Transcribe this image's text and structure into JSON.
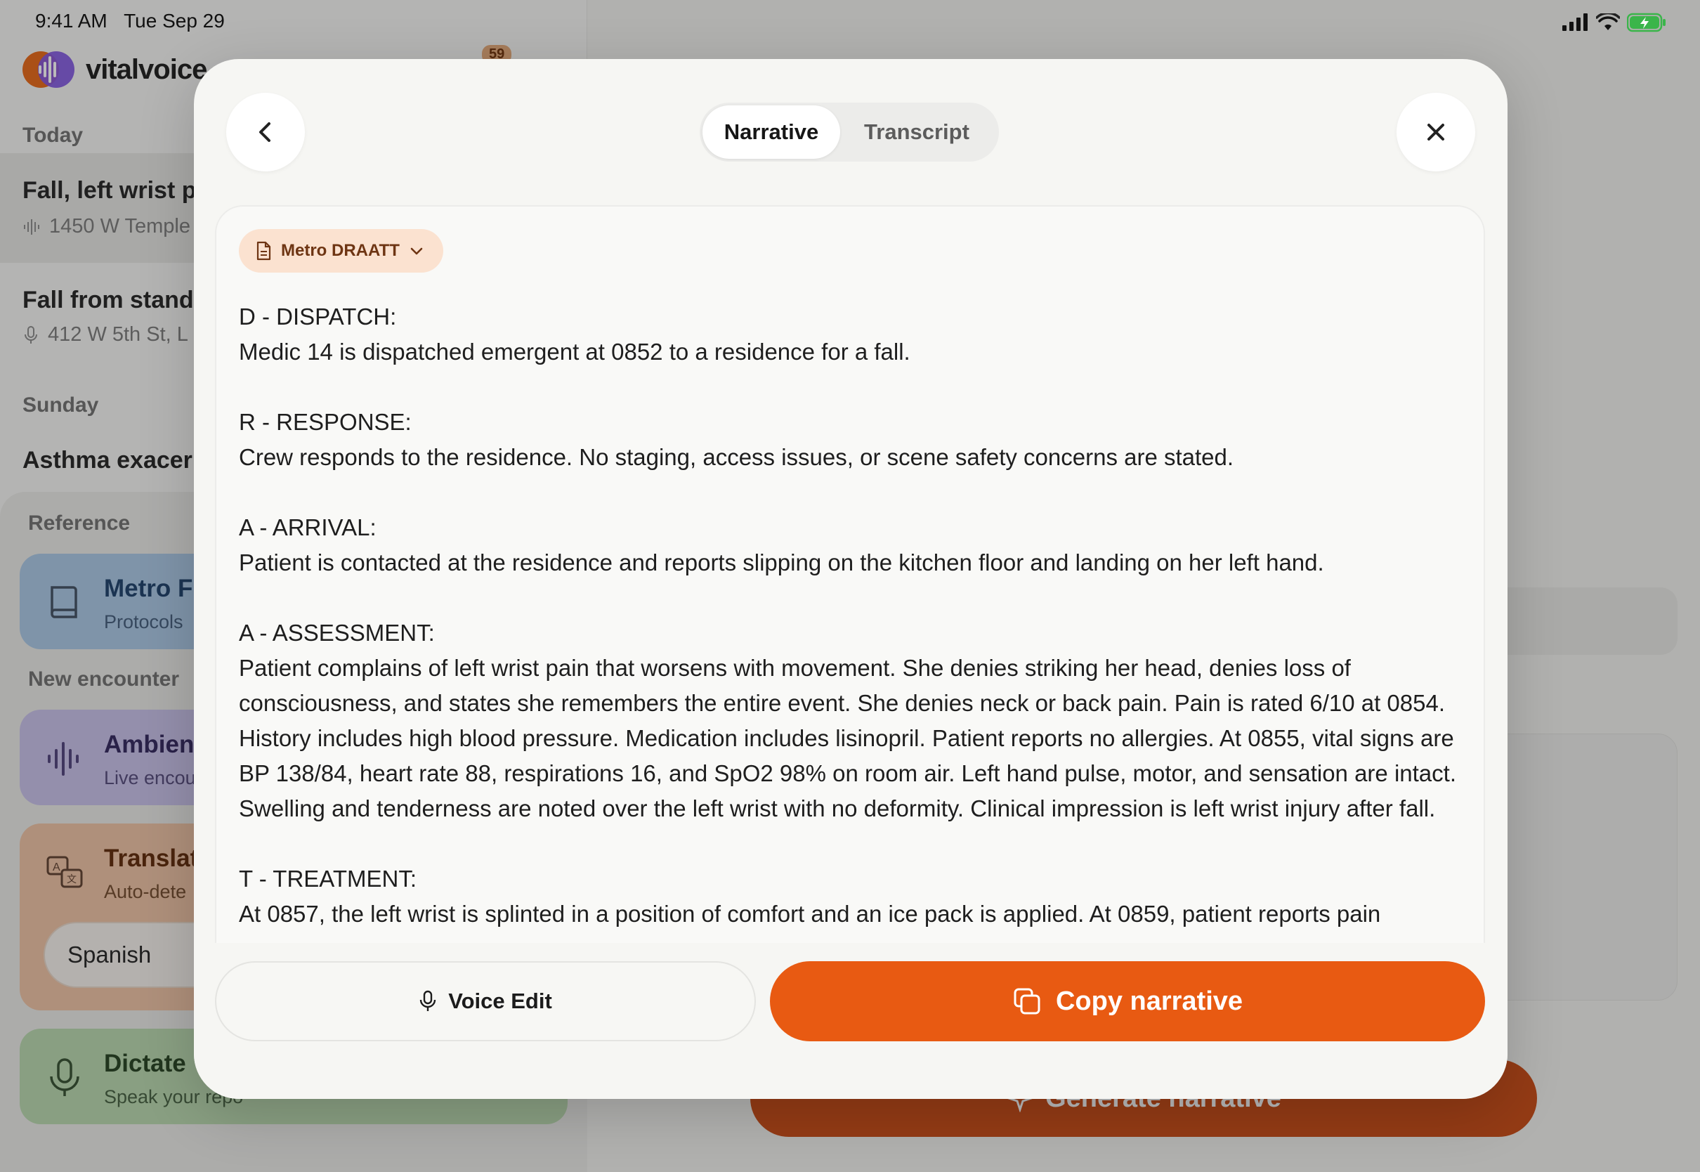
{
  "status": {
    "time": "9:41 AM",
    "date": "Tue Sep 29"
  },
  "brand": {
    "name": "vitalvoice",
    "badge": "59"
  },
  "sidebar": {
    "today_label": "Today",
    "sunday_label": "Sunday",
    "encounters": [
      {
        "title": "Fall, left wrist p",
        "subtitle": "1450 W Temple"
      },
      {
        "title": "Fall from standi",
        "subtitle": "412 W 5th St, L"
      },
      {
        "title": "Asthma exacerb",
        "subtitle": ""
      }
    ],
    "reference_label": "Reference",
    "reference_card": {
      "title": "Metro Fi",
      "subtitle": "Protocols"
    },
    "new_encounter_label": "New encounter",
    "ambient_card": {
      "title": "Ambien",
      "subtitle": "Live encou"
    },
    "translate_card": {
      "title": "Translat",
      "subtitle": "Auto-dete",
      "language": "Spanish"
    },
    "dictate_card": {
      "title": "Dictate",
      "subtitle": "Speak your repo"
    }
  },
  "main": {
    "generate_label": "Generate narrative"
  },
  "modal": {
    "tabs": [
      {
        "label": "Narrative",
        "active": true
      },
      {
        "label": "Transcript",
        "active": false
      }
    ],
    "template": "Metro DRAATT",
    "sections": [
      {
        "heading": "D - DISPATCH:",
        "body": "Medic 14 is dispatched emergent at 0852 to a residence for a fall."
      },
      {
        "heading": "R - RESPONSE:",
        "body": "Crew responds to the residence. No staging, access issues, or scene safety concerns are stated."
      },
      {
        "heading": "A - ARRIVAL:",
        "body": "Patient is contacted at the residence and reports slipping on the kitchen floor and landing on her left hand."
      },
      {
        "heading": "A - ASSESSMENT:",
        "body": "Patient complains of left wrist pain that worsens with movement. She denies striking her head, denies loss of consciousness, and states she remembers the entire event. She denies neck or back pain. Pain is rated 6/10 at 0854. History includes high blood pressure. Medication includes lisinopril. Patient reports no allergies. At 0855, vital signs are BP 138/84, heart rate 88, respirations 16, and SpO2 98% on room air. Left hand pulse, motor, and sensation are intact. Swelling and tenderness are noted over the left wrist with no deformity. Clinical impression is left wrist injury after fall."
      },
      {
        "heading": "T - TREATMENT:",
        "body": "At 0857, the left wrist is splinted in a position of comfort and an ice pack is applied. At 0859, patient reports pain"
      }
    ],
    "voice_edit_label": "Voice Edit",
    "copy_label": "Copy narrative"
  },
  "colors": {
    "accent": "#e85a12",
    "chip_bg": "#fbe2d0",
    "modal_bg": "#f6f6f3"
  }
}
